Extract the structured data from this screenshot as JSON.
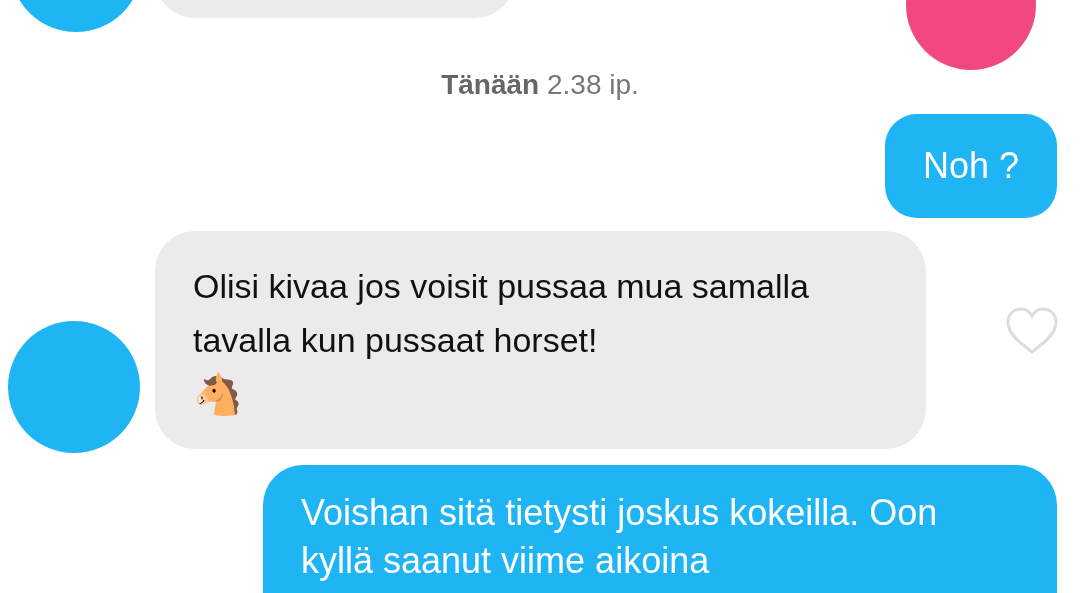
{
  "timestamp": "**Tänään** 2.38 ip.",
  "messages": [
    {
      "kind": "sent",
      "text": "Noh ?"
    },
    {
      "kind": "received",
      "text": "Olisi kivaa jos voisit pussaa mua samalla tavalla kun pussaat horset!",
      "emoji": "🐴",
      "liked": false
    },
    {
      "kind": "sent",
      "text": "Voishan sitä tietysti joskus kokeilla. Oon kyllä saanut viime aikoina"
    }
  ]
}
